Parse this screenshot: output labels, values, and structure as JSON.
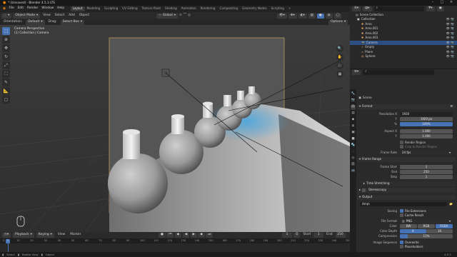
{
  "window": {
    "title": "* (Unsaved) - Blender 4.5.3 LTS"
  },
  "menu": [
    "File",
    "Edit",
    "Render",
    "Window",
    "Help"
  ],
  "workspaces": {
    "tabs": [
      "Layout",
      "Modeling",
      "Sculpting",
      "UV Editing",
      "Texture Paint",
      "Shading",
      "Animation",
      "Rendering",
      "Compositing",
      "Geometry Nodes",
      "Scripting"
    ],
    "active": "Layout",
    "add": "+"
  },
  "top_right": {
    "scene_label": "Scene",
    "view_layer_label": "ViewLayer"
  },
  "viewport": {
    "mode": "Object Mode",
    "view": "View",
    "select": "Select",
    "add": "Add",
    "object": "Object",
    "transform": "Global",
    "orientation_label": "Orientation:",
    "orientation_value": "Default",
    "drag_label": "Drag:",
    "drag_value": "Select Box",
    "options": "Options",
    "overlay_title": "Camera Perspective",
    "overlay_subtitle": "(1) Collection | Camera"
  },
  "timeline": {
    "playback": "Playback",
    "keying": "Keying",
    "view": "View",
    "marker": "Marker",
    "current_frame": "1",
    "start_label": "Start",
    "start": "1",
    "end_label": "End",
    "end": "250",
    "ruler_ticks": [
      "0",
      "10",
      "20",
      "30",
      "40",
      "50",
      "60",
      "70",
      "80",
      "90",
      "100",
      "110",
      "120",
      "130",
      "140",
      "150",
      "160",
      "170",
      "180",
      "190",
      "200",
      "210",
      "220",
      "230",
      "240",
      "250"
    ]
  },
  "outliner": {
    "header": "Scene Collection",
    "items": [
      {
        "name": "Collection",
        "indent": 1,
        "selected": false
      },
      {
        "name": "Area",
        "indent": 2,
        "selected": false
      },
      {
        "name": "Area.001",
        "indent": 2,
        "selected": false
      },
      {
        "name": "Area.002",
        "indent": 2,
        "selected": false
      },
      {
        "name": "Area.003",
        "indent": 2,
        "selected": false
      },
      {
        "name": "Camera",
        "indent": 2,
        "selected": true
      },
      {
        "name": "Empty",
        "indent": 2,
        "selected": false
      },
      {
        "name": "Plane",
        "indent": 2,
        "selected": false
      },
      {
        "name": "Sphere",
        "indent": 2,
        "selected": false
      }
    ]
  },
  "properties": {
    "context": "Scene",
    "format_section": "Format",
    "resolution_x_label": "Resolution X",
    "resolution_x": "1920",
    "y_label": "Y",
    "resolution_y": "1920 px",
    "percent_label": "%",
    "percent": "100%",
    "aspect_x_label": "Aspect X",
    "aspect_x": "1.000",
    "aspect_y_label": "Y",
    "aspect_y": "1.000",
    "render_region": "Render Region",
    "crop_region": "Crop to Render Region",
    "frame_rate_label": "Frame Rate",
    "frame_rate": "24 fps",
    "frame_range_section": "Frame Range",
    "frame_start_label": "Frame Start",
    "frame_start": "1",
    "end_label": "End",
    "end": "250",
    "step_label": "Step",
    "step": "1",
    "time_stretching": "Time Stretching",
    "stereoscopy": "Stereoscopy",
    "output_section": "Output",
    "output_path": "/tmp\\",
    "saving_label": "Saving",
    "file_extensions": "File Extensions",
    "cache_result": "Cache Result",
    "file_format_label": "File Format",
    "file_format": "PNG",
    "color_label": "Color",
    "color_options": [
      "BW",
      "RGB",
      "RGBA"
    ],
    "color_active": "RGBA",
    "color_depth_label": "Color Depth",
    "color_depth_options": [
      "8",
      "16"
    ],
    "color_depth_active": "8",
    "compression_label": "Compression",
    "compression": "15%",
    "image_sequence_label": "Image Sequence",
    "overwrite": "Overwrite",
    "placeholders": "Placeholders"
  },
  "status": {
    "select": "Select",
    "rotate_view": "Rotate View",
    "object": "Object",
    "version": "4.5.3"
  },
  "colors": {
    "accent": "#4772b3",
    "selected_row": "#2c4e82"
  }
}
